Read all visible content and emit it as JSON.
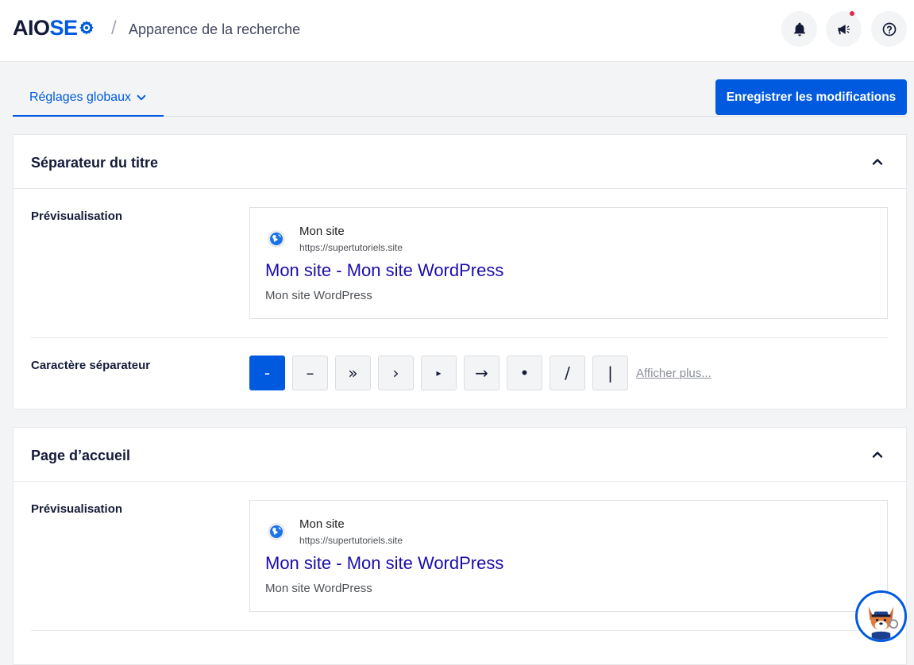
{
  "header": {
    "logo_aio": "AIO",
    "logo_seo": "SE",
    "breadcrumb_separator": "/",
    "page_title": "Apparence de la recherche",
    "icons": [
      "bell-icon",
      "megaphone-icon",
      "help-icon"
    ],
    "notification_dot_color": "#df2a4a"
  },
  "tabs": {
    "active_label": "Réglages globaux"
  },
  "toolbar": {
    "save_label": "Enregistrer les modifications"
  },
  "sections": [
    {
      "title": "Séparateur du titre",
      "preview_label": "Prévisualisation",
      "preview": {
        "site_name": "Mon site",
        "url": "https://supertutoriels.site",
        "title": "Mon site - Mon site WordPress",
        "description": "Mon site WordPress"
      },
      "separator_label": "Caractère séparateur",
      "separators": [
        "-",
        "–",
        "»",
        "›",
        "▸",
        "→",
        "•",
        "/",
        "|"
      ],
      "selected_separator": "-",
      "more_link": "Afficher plus..."
    },
    {
      "title": "Page d’accueil",
      "preview_label": "Prévisualisation",
      "preview": {
        "site_name": "Mon site",
        "url": "https://supertutoriels.site",
        "title": "Mon site - Mon site WordPress",
        "description": "Mon site WordPress"
      }
    }
  ],
  "colors": {
    "accent": "#005ae0",
    "serp_title": "#1a0dab",
    "text_dark": "#141b38"
  }
}
